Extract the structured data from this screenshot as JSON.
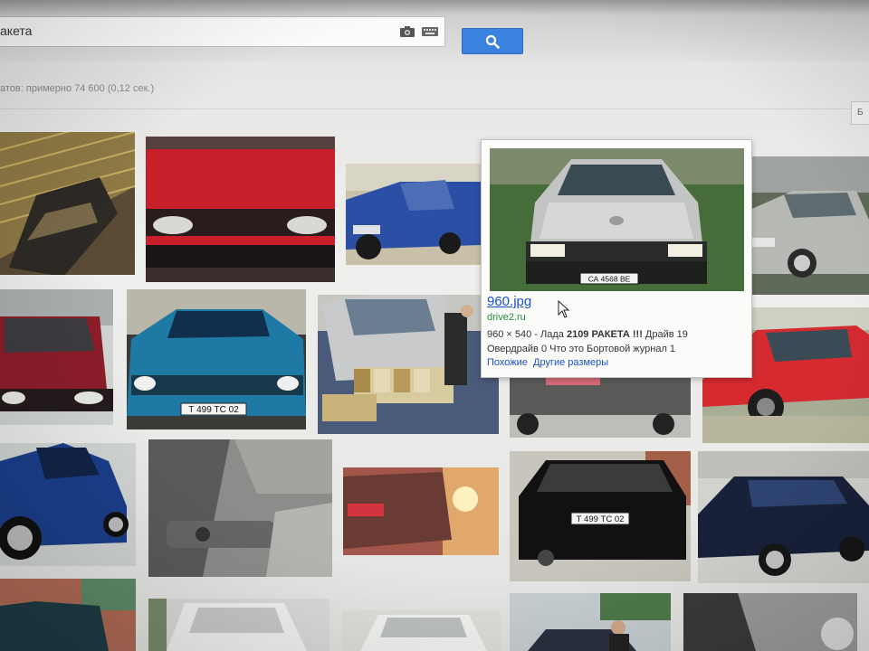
{
  "search": {
    "query": "акета",
    "camera_icon": "camera-icon",
    "keyboard_icon": "keyboard-icon",
    "button_icon": "magnifier-icon"
  },
  "results_info": "атов: примерно 74 600 (0,12 сек.)",
  "side_tab": "Б",
  "colors": {
    "accent": "#3b82e0",
    "link": "#1a4fc9",
    "domain_green": "#2a8a3a"
  },
  "grid_images": [
    {
      "name": "image-gold-car-grille"
    },
    {
      "name": "image-red-lada-front"
    },
    {
      "name": "image-blue-lada-side"
    },
    {
      "name": "image-silver-lada-tuned"
    },
    {
      "name": "image-maroon-lada-front"
    },
    {
      "name": "image-turquoise-lada-front"
    },
    {
      "name": "image-silver-lada-show"
    },
    {
      "name": "image-grey-lada-rear"
    },
    {
      "name": "image-red-lada-side"
    },
    {
      "name": "image-blue-lada-wheels"
    },
    {
      "name": "image-interior-gear-shift"
    },
    {
      "name": "image-lada-rear-sunset"
    },
    {
      "name": "image-black-lada-rear"
    },
    {
      "name": "image-black-lada-side"
    },
    {
      "name": "image-green-lada-bottom"
    },
    {
      "name": "image-white-lada-raketa-1"
    },
    {
      "name": "image-white-lada-raketa-2"
    },
    {
      "name": "image-lada-people"
    },
    {
      "name": "image-dark-lada-bottom"
    }
  ],
  "tooltip": {
    "filename": "960.jpg",
    "domain": "drive2.ru",
    "size_prefix": "960 × 540 - Лада ",
    "title_bold": "2109 РАКЕТА !!!",
    "size_suffix": " Драйв 19",
    "line2": "Овердрайв 0 Что это Бортовой журнал 1",
    "link_similar": "Похожие",
    "link_sizes": "Другие размеры",
    "plate_text": "СА 4568 ВЕ"
  },
  "plates": {
    "turquoise": "Т 499 ТС 02",
    "black_rear": "Т 499 ТС 02"
  }
}
